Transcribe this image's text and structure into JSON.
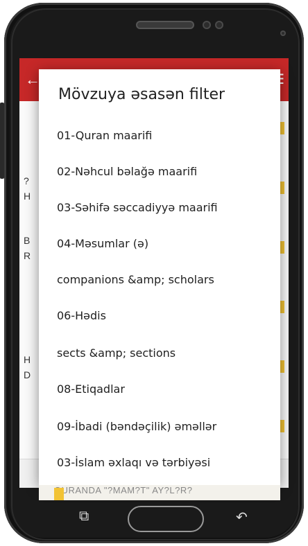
{
  "dialog": {
    "title": "Mövzuya əsasən filter",
    "options": [
      "01-Quran maarifi",
      "02-Nəhcul bəlağə maarifi",
      "03-Səhifə səccadiyyə maarifi",
      "04-Məsumlar (ə)",
      " companions &amp; scholars",
      "06-Hədis",
      " sects &amp; sections",
      "08-Etiqadlar",
      "09-İbadi (bəndəçilik) əməllər",
      "03-İslam əxlaqı və tərbiyəsi"
    ]
  },
  "background": {
    "row_texts": [
      "?",
      "H",
      "B",
      "R",
      "H",
      "D"
    ],
    "bottom_text": "QURANDA \"?MAM?T\" AY?L?R?"
  },
  "colors": {
    "appbar": "#c62828",
    "checkbox": "#f2c335"
  },
  "icons": {
    "back": "arrow-back-icon",
    "menu": "menu-icon",
    "recent_apps": "recent-apps-icon",
    "home": "home-button",
    "nav_back": "nav-back-icon"
  }
}
